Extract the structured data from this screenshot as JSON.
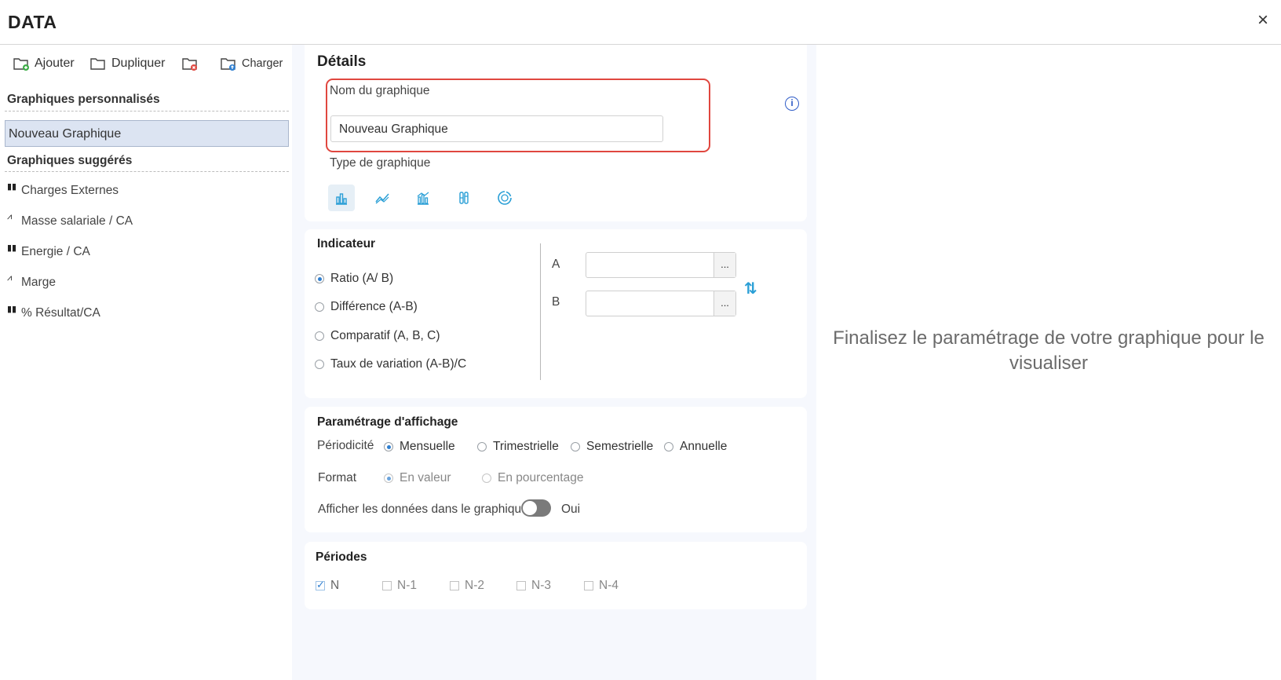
{
  "app": {
    "title": "DATA",
    "close": "×"
  },
  "toolbar": {
    "add_label": "Ajouter",
    "duplicate_label": "Dupliquer",
    "load_label": "Charger"
  },
  "sidebar": {
    "custom_header": "Graphiques personnalisés",
    "custom_items": [
      {
        "label": "Nouveau Graphique",
        "selected": true
      }
    ],
    "suggested_header": "Graphiques suggérés",
    "suggested_items": [
      {
        "label": "Charges Externes",
        "icon": "bar-chart-icon"
      },
      {
        "label": "Masse salariale / CA",
        "icon": "line-chart-icon"
      },
      {
        "label": "Energie / CA",
        "icon": "bar-chart-icon"
      },
      {
        "label": "Marge",
        "icon": "line-chart-icon"
      },
      {
        "label": "% Résultat/CA",
        "icon": "bar-chart-icon"
      }
    ]
  },
  "details": {
    "title": "Détails",
    "name_label": "Nom du graphique",
    "name_value": "Nouveau Graphique",
    "type_label": "Type de graphique",
    "chart_types": [
      {
        "icon": "bar-chart-icon",
        "active": true
      },
      {
        "icon": "line-chart-icon",
        "active": false
      },
      {
        "icon": "bar-line-combo-icon",
        "active": false
      },
      {
        "icon": "stacked-bar-icon",
        "active": false
      },
      {
        "icon": "donut-chart-icon",
        "active": false
      }
    ],
    "accent_color": "#2a9fd6",
    "highlight_color": "#e0473f"
  },
  "indicator": {
    "title": "Indicateur",
    "options": [
      {
        "label": "Ratio (A/ B)",
        "selected": true
      },
      {
        "label": "Différence (A-B)",
        "selected": false
      },
      {
        "label": "Comparatif (A, B, C)",
        "selected": false
      },
      {
        "label": "Taux de variation (A-B)/C",
        "selected": false
      }
    ],
    "field_a_label": "A",
    "field_a_value": "",
    "field_b_label": "B",
    "field_b_value": "",
    "browse": "..."
  },
  "display": {
    "title": "Paramétrage d'affichage",
    "periodicity_label": "Périodicité",
    "periodicity_options": [
      {
        "label": "Mensuelle",
        "selected": true
      },
      {
        "label": "Trimestrielle",
        "selected": false
      },
      {
        "label": "Semestrielle",
        "selected": false
      },
      {
        "label": "Annuelle",
        "selected": false
      }
    ],
    "format_label": "Format",
    "format_options": [
      {
        "label": "En valeur",
        "selected": true
      },
      {
        "label": "En pourcentage",
        "selected": false
      }
    ],
    "show_data_label": "Afficher les données dans le graphique",
    "show_data_value": "Oui"
  },
  "periods": {
    "title": "Périodes",
    "items": [
      {
        "label": "N",
        "checked": true
      },
      {
        "label": "N-1",
        "checked": false
      },
      {
        "label": "N-2",
        "checked": false
      },
      {
        "label": "N-3",
        "checked": false
      },
      {
        "label": "N-4",
        "checked": false
      }
    ]
  },
  "preview": {
    "message": "Finalisez le paramétrage de votre graphique pour le visualiser"
  }
}
